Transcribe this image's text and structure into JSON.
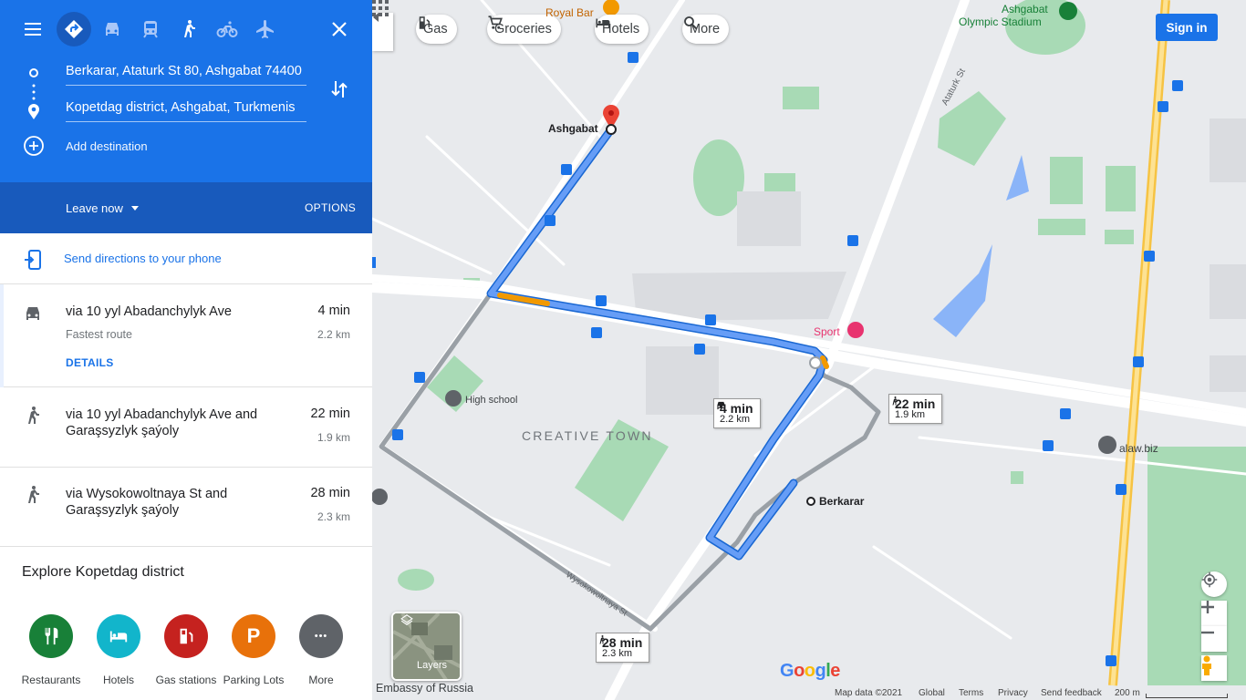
{
  "directions": {
    "origin": "Berkarar, Ataturk St 80, Ashgabat 74400",
    "destination": "Kopetdag district, Ashgabat, Turkmenis",
    "add_destination": "Add destination",
    "leave_now": "Leave now",
    "options": "OPTIONS",
    "send_to_phone": "Send directions to your phone",
    "travel_modes": [
      "best-route",
      "driving",
      "transit",
      "walking",
      "cycling",
      "flights"
    ],
    "selected_mode": "best-route"
  },
  "routes": [
    {
      "mode": "car-icon",
      "title": "via 10 yyl Abadanchylyk Ave",
      "time": "4 min",
      "distance": "2.2 km",
      "subtitle": "Fastest route",
      "details": "DETAILS"
    },
    {
      "mode": "walk-icon",
      "title": "via 10 yyl Abadanchylyk Ave and Garaşsyzlyk şaýoly",
      "time": "22 min",
      "distance": "1.9 km"
    },
    {
      "mode": "walk-icon",
      "title": "via Wysokowoltnaya St and Garaşsyzlyk şaýoly",
      "time": "28 min",
      "distance": "2.3 km"
    }
  ],
  "explore": {
    "title": "Explore Kopetdag district",
    "categories": [
      {
        "label": "Restaurants",
        "color": "#188038",
        "icon": "fork-knife-icon"
      },
      {
        "label": "Hotels",
        "color": "#12b5cb",
        "icon": "bed-icon"
      },
      {
        "label": "Gas stations",
        "color": "#c5221f",
        "icon": "gas-pump-icon"
      },
      {
        "label": "Parking Lots",
        "color": "#e8710a",
        "icon": "parking-icon",
        "glyph": "P"
      },
      {
        "label": "More",
        "color": "#5f6368",
        "icon": "more-icon",
        "glyph": "•••"
      }
    ]
  },
  "map": {
    "chips": [
      "Gas",
      "Groceries",
      "Hotels",
      "More"
    ],
    "sign_in": "Sign in",
    "labels": {
      "ashgabat": "Ashgabat",
      "berkarar": "Berkarar",
      "creative_town": "CREATIVE TOWN",
      "high_school": "High school",
      "sport": "Sport",
      "alaw": "alaw.biz",
      "olympic_1": "Ashgabat",
      "olympic_2": "Olympic Stadium",
      "royal_bar": "Royal Bar",
      "ataturk": "Ataturk St",
      "wysoko": "Wysokowoltnaya St",
      "embassy": "Embassy of Russia"
    },
    "badges": {
      "car": {
        "time": "4 min",
        "dist": "2.2 km"
      },
      "walk1": {
        "time": "22 min",
        "dist": "1.9 km"
      },
      "walk2": {
        "time": "28 min",
        "dist": "2.3 km"
      }
    },
    "layers": "Layers",
    "google": [
      "G",
      "o",
      "o",
      "g",
      "l",
      "e"
    ],
    "attribution": {
      "data": "Map data ©2021",
      "global": "Global",
      "terms": "Terms",
      "privacy": "Privacy",
      "feedback": "Send feedback",
      "scale": "200 m"
    }
  }
}
